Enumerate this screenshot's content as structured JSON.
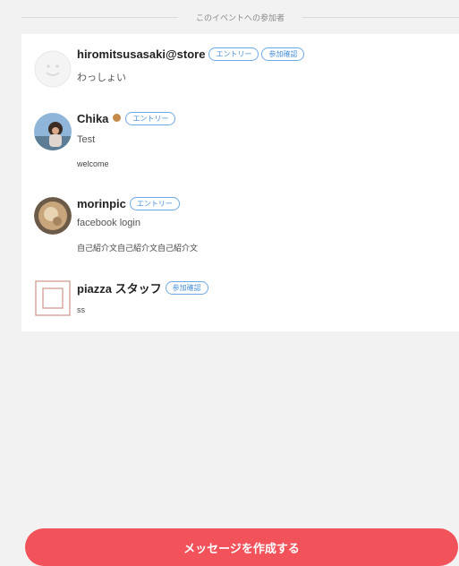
{
  "section_title": "このイベントへの参加者",
  "participants": [
    {
      "name": "hiromitsusasaki@store",
      "badges": [
        "エントリー",
        "参加確認"
      ],
      "subtitle": "わっしょい",
      "bio": ""
    },
    {
      "name": "Chika",
      "badges": [
        "エントリー"
      ],
      "subtitle": "Test",
      "bio": "welcome"
    },
    {
      "name": "morinpic",
      "badges": [
        "エントリー"
      ],
      "subtitle": "facebook login",
      "bio": "自己紹介文自己紹介文自己紹介文"
    },
    {
      "name": "piazza スタッフ",
      "badges": [
        "参加確認"
      ],
      "subtitle": "ss",
      "bio": ""
    }
  ],
  "compose_button_label": "メッセージを作成する",
  "colors": {
    "accent": "#f2525a",
    "badge": "#4a90d9",
    "background": "#f2f2f2"
  }
}
